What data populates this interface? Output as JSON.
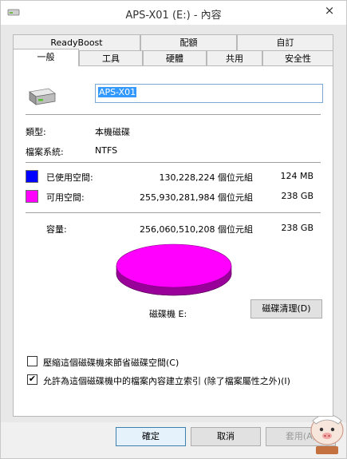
{
  "window": {
    "title": "APS-X01 (E:) - 內容",
    "close_icon": "×"
  },
  "tabs_row1": [
    {
      "label": "ReadyBoost"
    },
    {
      "label": "配額"
    },
    {
      "label": "自訂"
    }
  ],
  "tabs_row2": [
    {
      "label": "一般",
      "active": true
    },
    {
      "label": "工具"
    },
    {
      "label": "硬體"
    },
    {
      "label": "共用"
    },
    {
      "label": "安全性"
    }
  ],
  "general": {
    "drive_name": "APS-X01",
    "type_label": "類型:",
    "type_value": "本機磁碟",
    "fs_label": "檔案系統:",
    "fs_value": "NTFS",
    "used_label": "已使用空間:",
    "used_bytes": "130,228,224 個位元組",
    "used_size": "124 MB",
    "used_color": "#0000ff",
    "free_label": "可用空間:",
    "free_bytes": "255,930,281,984 個位元組",
    "free_size": "238 GB",
    "free_color": "#ff00ff",
    "capacity_label": "容量:",
    "capacity_bytes": "256,060,510,208 個位元組",
    "capacity_size": "238 GB",
    "drive_label": "磁碟機 E:",
    "cleanup_button": "磁碟清理(D)",
    "compress_label": "壓縮這個磁碟機來節省磁碟空間(C)",
    "compress_checked": false,
    "index_label": "允許為這個磁碟機中的檔案內容建立索引 (除了檔案屬性之外)(I)",
    "index_checked": true
  },
  "buttons": {
    "ok": "確定",
    "cancel": "取消",
    "apply": "套用(A)"
  }
}
